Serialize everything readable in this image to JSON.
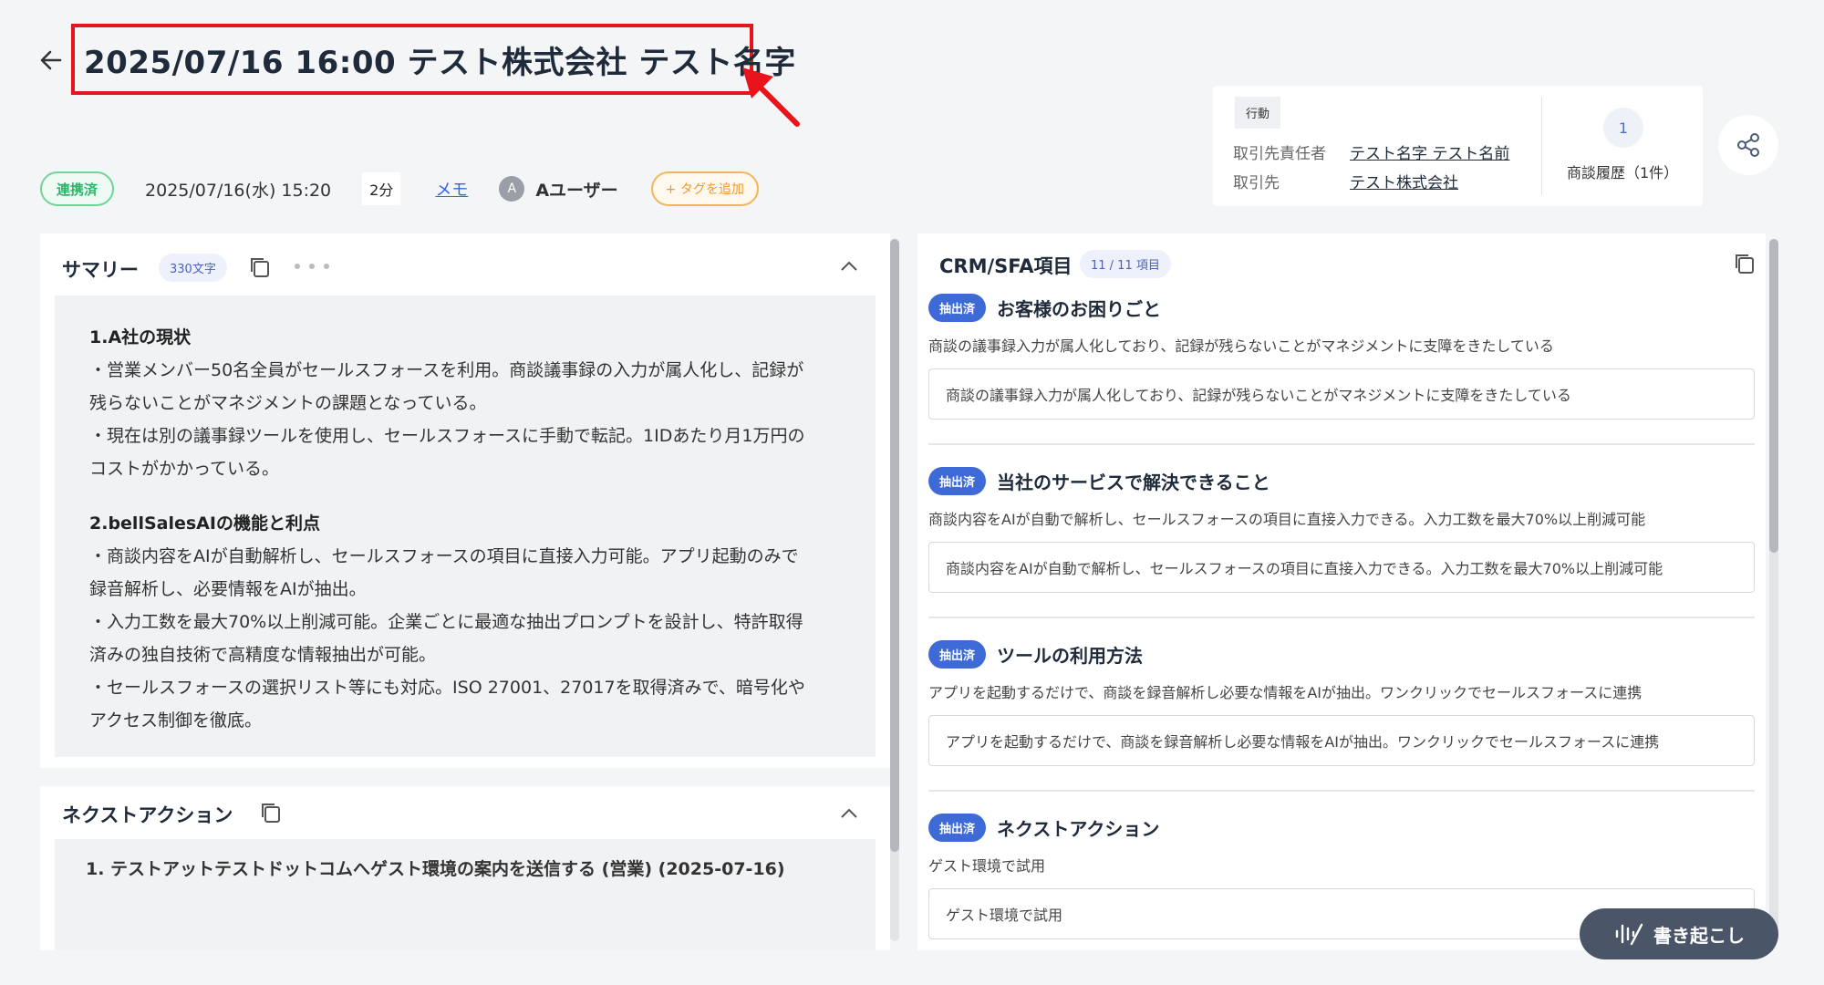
{
  "header": {
    "title": "2025/07/16 16:00 テスト株式会社 テスト名字"
  },
  "info": {
    "status": "連携済",
    "datetime": "2025/07/16(水) 15:20",
    "duration": "2分",
    "memo": "メモ",
    "avatar_initial": "A",
    "user": "Aユーザー",
    "add_tag": "+ タグを追加"
  },
  "deal_card": {
    "action_label": "行動",
    "contact_label": "取引先責任者",
    "contact_value": "テスト名字 テスト名前",
    "account_label": "取引先",
    "account_value": "テスト株式会社",
    "history_count": "1",
    "history_label": "商談履歴（1件）"
  },
  "summary": {
    "title": "サマリー",
    "char_count": "330文字",
    "lines": [
      {
        "type": "heading",
        "text": "1.A社の現状"
      },
      {
        "type": "text",
        "text": "・営業メンバー50名全員がセールスフォースを利用。商談議事録の入力が属人化し、記録が"
      },
      {
        "type": "text",
        "text": "残らないことがマネジメントの課題となっている。"
      },
      {
        "type": "text",
        "text": "・現在は別の議事録ツールを使用し、セールスフォースに手動で転記。1IDあたり月1万円の"
      },
      {
        "type": "text",
        "text": "コストがかかっている。"
      },
      {
        "type": "heading",
        "text": "2.bellSalesAIの機能と利点"
      },
      {
        "type": "text",
        "text": "・商談内容をAIが自動解析し、セールスフォースの項目に直接入力可能。アプリ起動のみで"
      },
      {
        "type": "text",
        "text": "録音解析し、必要情報をAIが抽出。"
      },
      {
        "type": "text",
        "text": "・入力工数を最大70%以上削減可能。企業ごとに最適な抽出プロンプトを設計し、特許取得"
      },
      {
        "type": "text",
        "text": "済みの独自技術で高精度な情報抽出が可能。"
      },
      {
        "type": "text",
        "text": "・セールスフォースの選択リスト等にも対応。ISO 27001、27017を取得済みで、暗号化や"
      },
      {
        "type": "text",
        "text": "アクセス制御を徹底。"
      }
    ]
  },
  "next_action": {
    "title": "ネクストアクション",
    "item": "1. テストアットテストドットコムへゲスト環境の案内を送信する (営業) (2025-07-16)"
  },
  "crm": {
    "title": "CRM/SFA項目",
    "count": "11 / 11 項目",
    "sections": [
      {
        "badge": "抽出済",
        "title": "お客様のお困りごと",
        "desc": "商談の議事録入力が属人化しており、記録が残らないことがマネジメントに支障をきたしている",
        "value": "商談の議事録入力が属人化しており、記録が残らないことがマネジメントに支障をきたしている"
      },
      {
        "badge": "抽出済",
        "title": "当社のサービスで解決できること",
        "desc": "商談内容をAIが自動で解析し、セールスフォースの項目に直接入力できる。入力工数を最大70%以上削減可能",
        "value": "商談内容をAIが自動で解析し、セールスフォースの項目に直接入力できる。入力工数を最大70%以上削減可能"
      },
      {
        "badge": "抽出済",
        "title": "ツールの利用方法",
        "desc": "アプリを起動するだけで、商談を録音解析し必要な情報をAIが抽出。ワンクリックでセールスフォースに連携",
        "value": "アプリを起動するだけで、商談を録音解析し必要な情報をAIが抽出。ワンクリックでセールスフォースに連携"
      },
      {
        "badge": "抽出済",
        "title": "ネクストアクション",
        "desc": "ゲスト環境で試用",
        "value": "ゲスト環境で試用"
      }
    ]
  },
  "transcribe_button": "書き起こし",
  "colors": {
    "highlight_red": "#e8131b",
    "badge_blue": "#3d6ad6",
    "status_green": "#2fb56b",
    "tag_orange": "#ef9a2e",
    "fab_dark": "#4a5568"
  }
}
